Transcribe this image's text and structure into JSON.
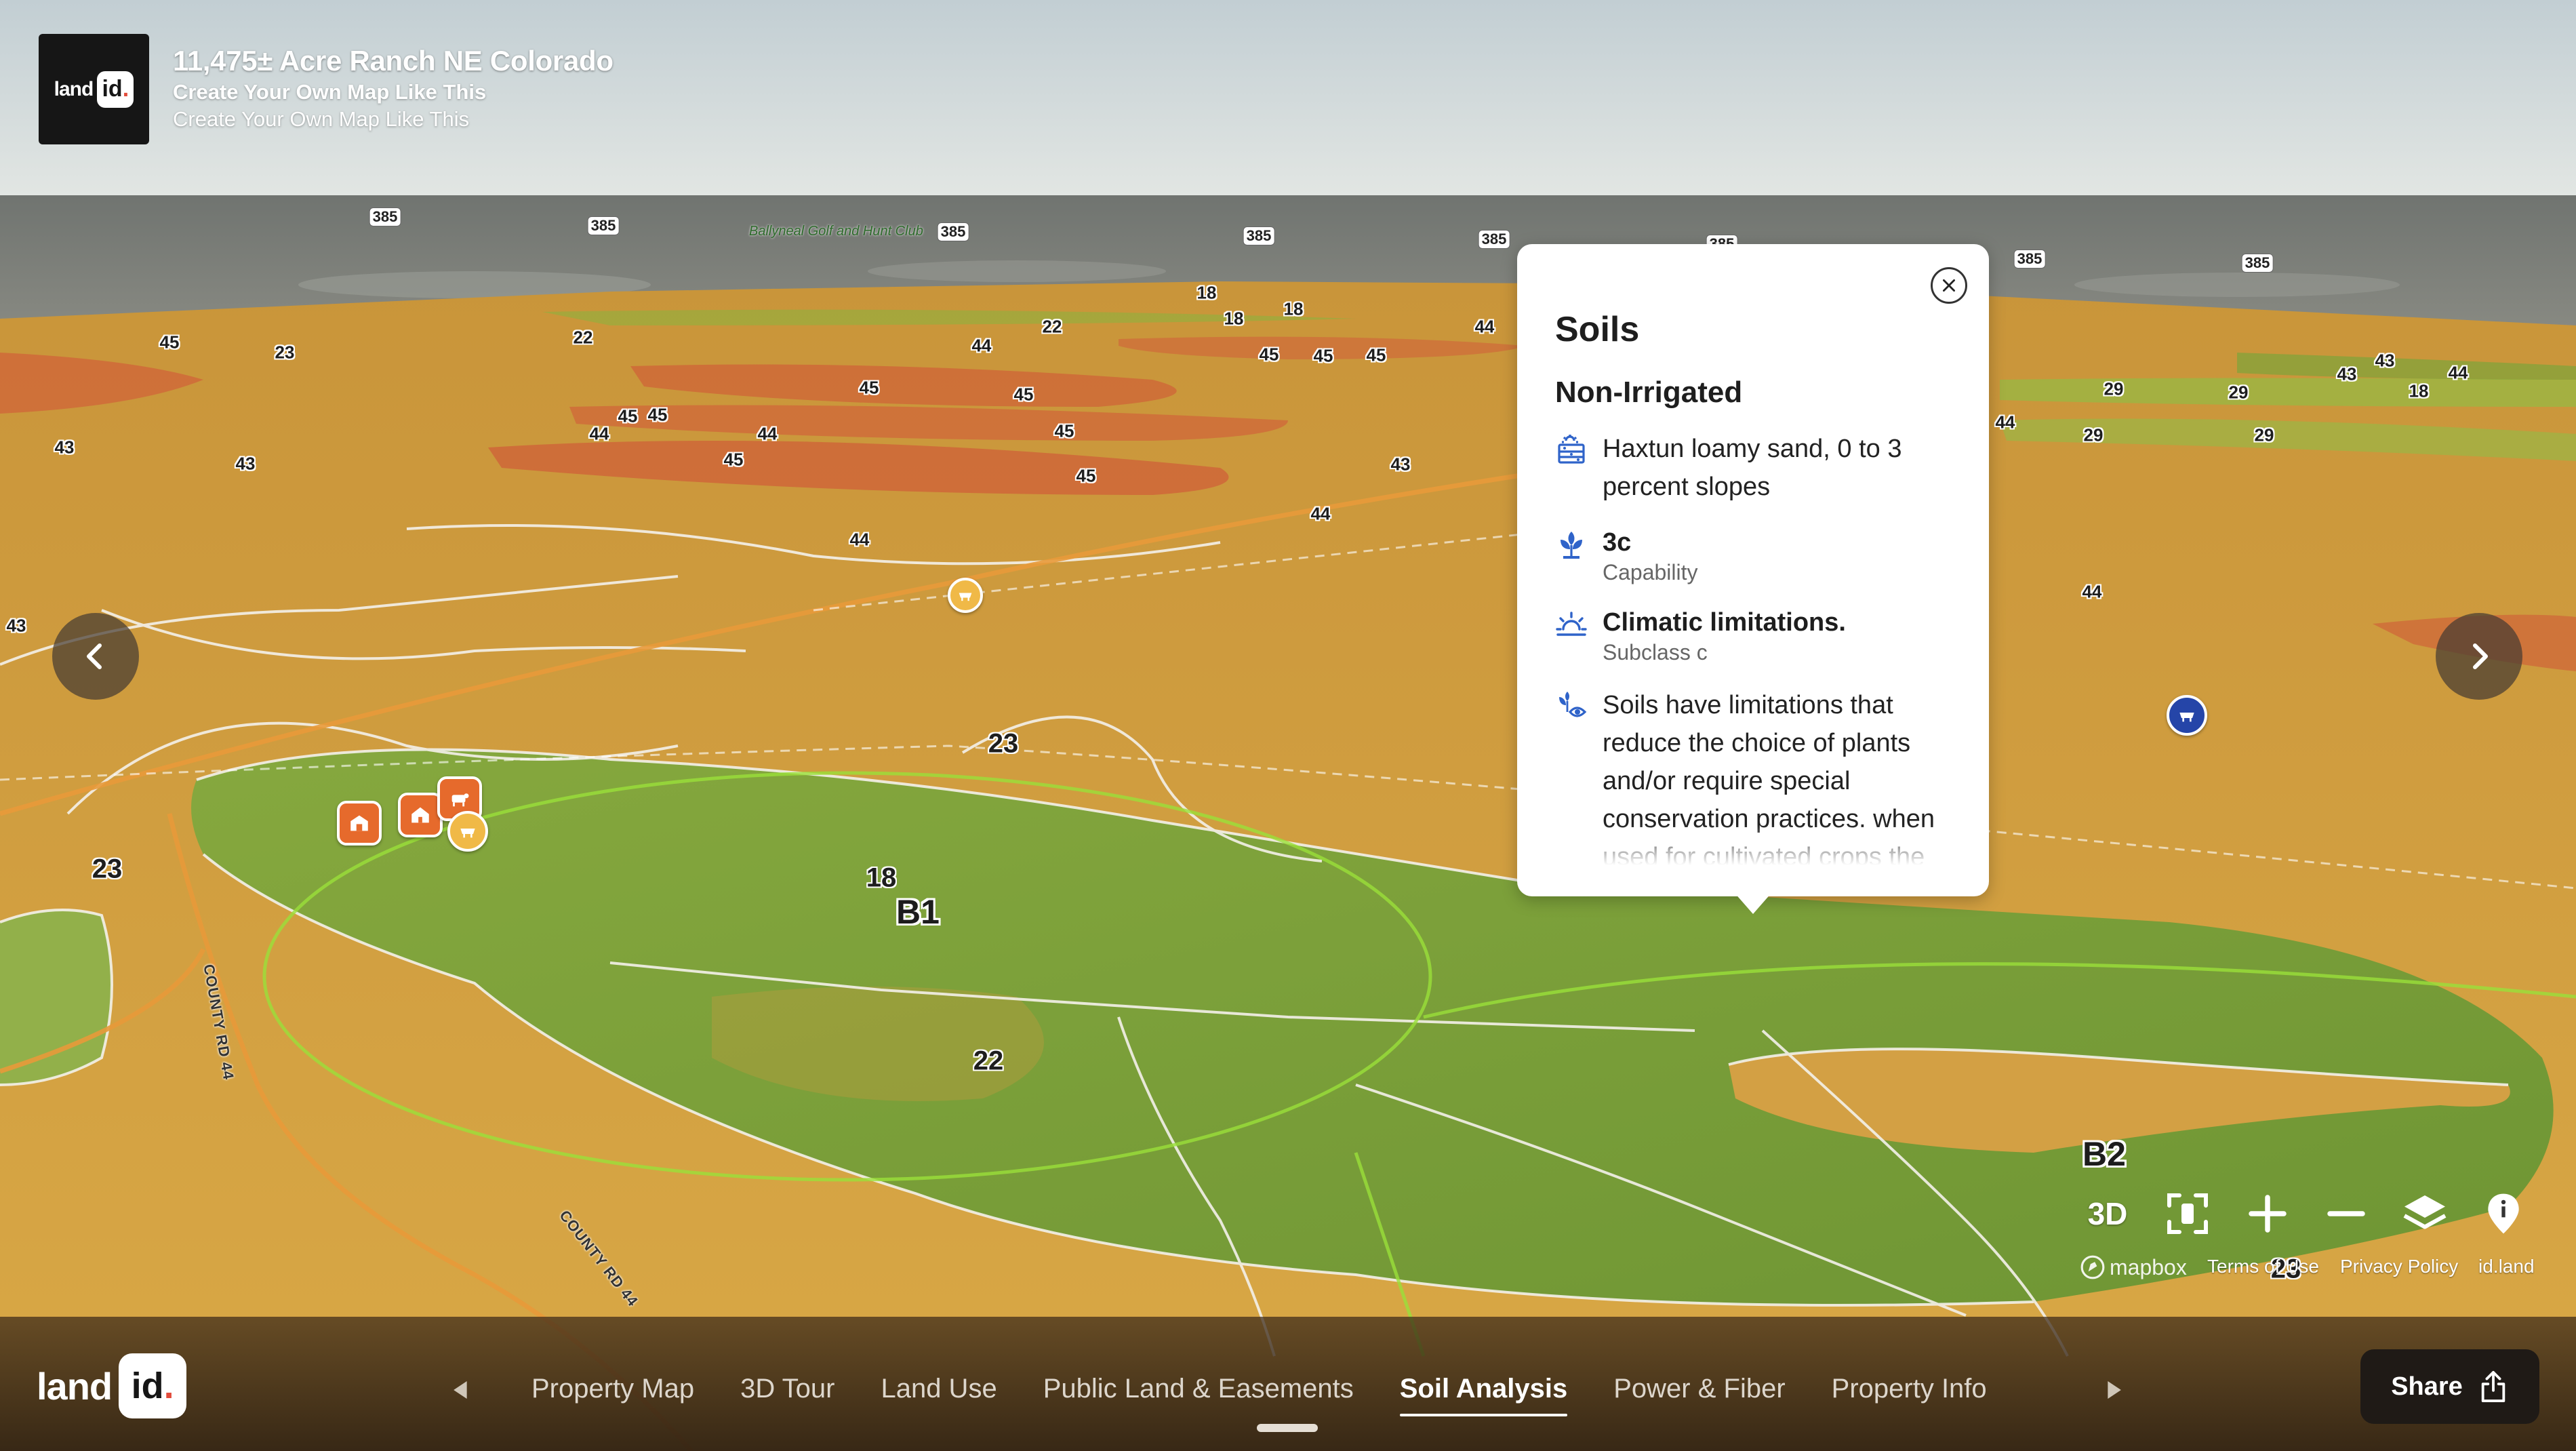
{
  "header": {
    "logo_word": "land",
    "logo_id": "id",
    "title": "11,475± Acre Ranch NE Colorado",
    "subtitle": "Create Your Own Map Like This",
    "subtitle_repeat": "Create Your Own Map Like This"
  },
  "map_labels": {
    "golf": "Ballyneal Golf and Hunt Club",
    "road_a": "COUNTY RD 44",
    "road_b": "COUNTY RD 44",
    "soil_unit_b1": "B1",
    "soil_unit_b2": "B2",
    "soil_18": "18",
    "soil_22": "22",
    "soil_23": "23",
    "soil_23b": "23",
    "soil_28": "23",
    "shields": [
      "385",
      "385",
      "385",
      "385",
      "385",
      "385",
      "385",
      "385",
      "18",
      "18",
      "18",
      "22",
      "22",
      "23",
      "43",
      "43",
      "43",
      "43",
      "44",
      "44",
      "44",
      "44",
      "44",
      "44",
      "44",
      "44",
      "45",
      "45",
      "45",
      "45",
      "45",
      "45",
      "45",
      "45",
      "45",
      "45",
      "45",
      "29",
      "29",
      "29",
      "29",
      "43",
      "43",
      "18",
      "44"
    ]
  },
  "popup": {
    "title": "Soils",
    "category": "Non-Irrigated",
    "soil_name": "Haxtun loamy sand, 0 to 3 percent slopes",
    "capability_value": "3c",
    "capability_label": "Capability",
    "subclass_value": "Climatic limitations.",
    "subclass_label": "Subclass c",
    "description": "Soils have limitations that reduce the choice of plants and/or require special conservation practices. when used for cultivated crops the"
  },
  "controls": {
    "three_d": "3D",
    "mapbox": "mapbox",
    "terms": "Terms of Use",
    "privacy": "Privacy Policy",
    "idland": "id.land"
  },
  "bottom_nav": {
    "logo_word": "land",
    "logo_id": "id",
    "tabs": [
      "Property Map",
      "3D Tour",
      "Land Use",
      "Public Land & Easements",
      "Soil Analysis",
      "Power & Fiber",
      "Property Info"
    ],
    "active_tab": "Soil Analysis",
    "share_label": "Share"
  },
  "colors": {
    "soil_orange": "#d6a03e",
    "soil_green": "#7ea43a",
    "soil_red": "#d4663a",
    "accent_blue": "#2f63c9",
    "bar_dark": "#1f1a16"
  },
  "icons": [
    "chevron-left-icon",
    "chevron-right-icon",
    "close-icon",
    "soil-texture-icon",
    "capability-plant-icon",
    "sun-icon",
    "plant-eye-icon",
    "fit-bounds-icon",
    "plus-icon",
    "minus-icon",
    "layers-icon",
    "info-pin-icon",
    "share-icon",
    "barn-icon",
    "home-icon",
    "cow-icon",
    "pig-icon",
    "tractor-icon"
  ]
}
